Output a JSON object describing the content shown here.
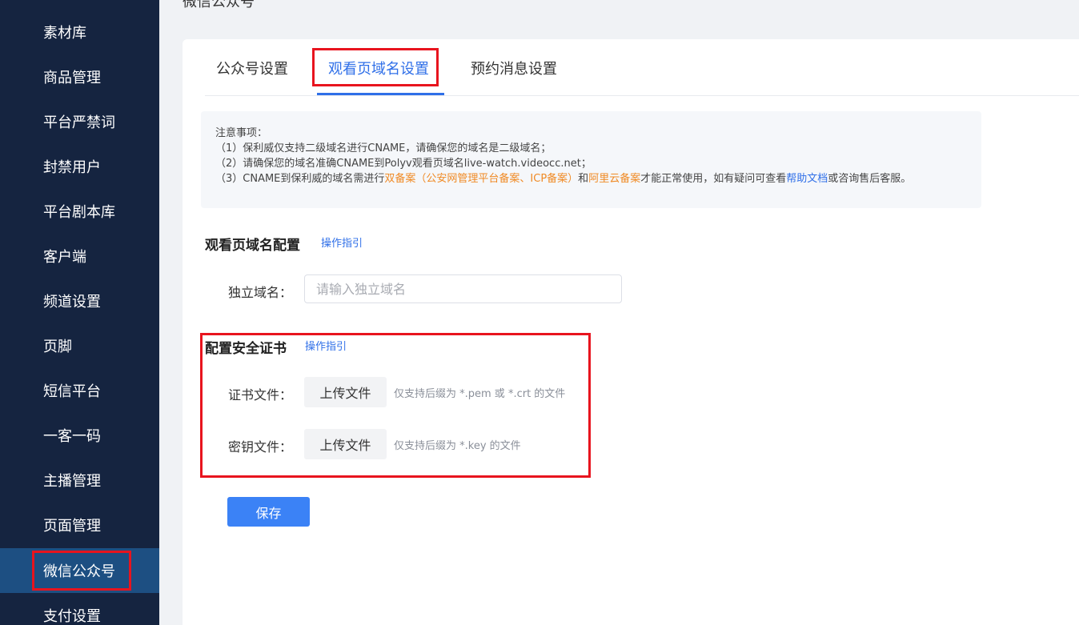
{
  "page_title": "微信公众号",
  "sidebar": {
    "items": [
      {
        "label": "素材库"
      },
      {
        "label": "商品管理"
      },
      {
        "label": "平台严禁词"
      },
      {
        "label": "封禁用户"
      },
      {
        "label": "平台剧本库"
      },
      {
        "label": "客户端"
      },
      {
        "label": "频道设置"
      },
      {
        "label": "页脚"
      },
      {
        "label": "短信平台"
      },
      {
        "label": "一客一码"
      },
      {
        "label": "主播管理"
      },
      {
        "label": "页面管理"
      },
      {
        "label": "微信公众号",
        "active": true
      },
      {
        "label": "支付设置"
      }
    ]
  },
  "tabs": [
    {
      "label": "公众号设置"
    },
    {
      "label": "观看页域名设置",
      "active": true
    },
    {
      "label": "预约消息设置"
    }
  ],
  "notice": {
    "heading": "注意事项：",
    "line1": "（1）保利威仅支持二级域名进行CNAME，请确保您的域名是二级域名；",
    "line2": "（2）请确保您的域名准确CNAME到Polyv观看页域名live-watch.videocc.net；",
    "line3_a": "（3）CNAME到保利威的域名需进行",
    "line3_b": "双备案（公安网管理平台备案、ICP备案）",
    "line3_c": "和",
    "line3_d": "阿里云备案",
    "line3_e": "才能正常使用，如有疑问可查看",
    "line3_f": "帮助文档",
    "line3_g": "或咨询售后客服。"
  },
  "domain_section": {
    "title": "观看页域名配置",
    "guide_link": "操作指引",
    "field_label": "独立域名：",
    "placeholder": "请输入独立域名",
    "value": ""
  },
  "cert_section": {
    "title": "配置安全证书",
    "guide_link": "操作指引",
    "cert_label": "证书文件：",
    "cert_button": "上传文件",
    "cert_hint": "仅支持后缀为 *.pem 或 *.crt 的文件",
    "key_label": "密钥文件：",
    "key_button": "上传文件",
    "key_hint": "仅支持后缀为 *.key 的文件"
  },
  "save_label": "保存",
  "colors": {
    "sidebar_bg": "#152440",
    "sidebar_active": "#1d4f82",
    "accent": "#2f6fe8",
    "highlight": "#e8141e",
    "warning": "#f08a24"
  }
}
